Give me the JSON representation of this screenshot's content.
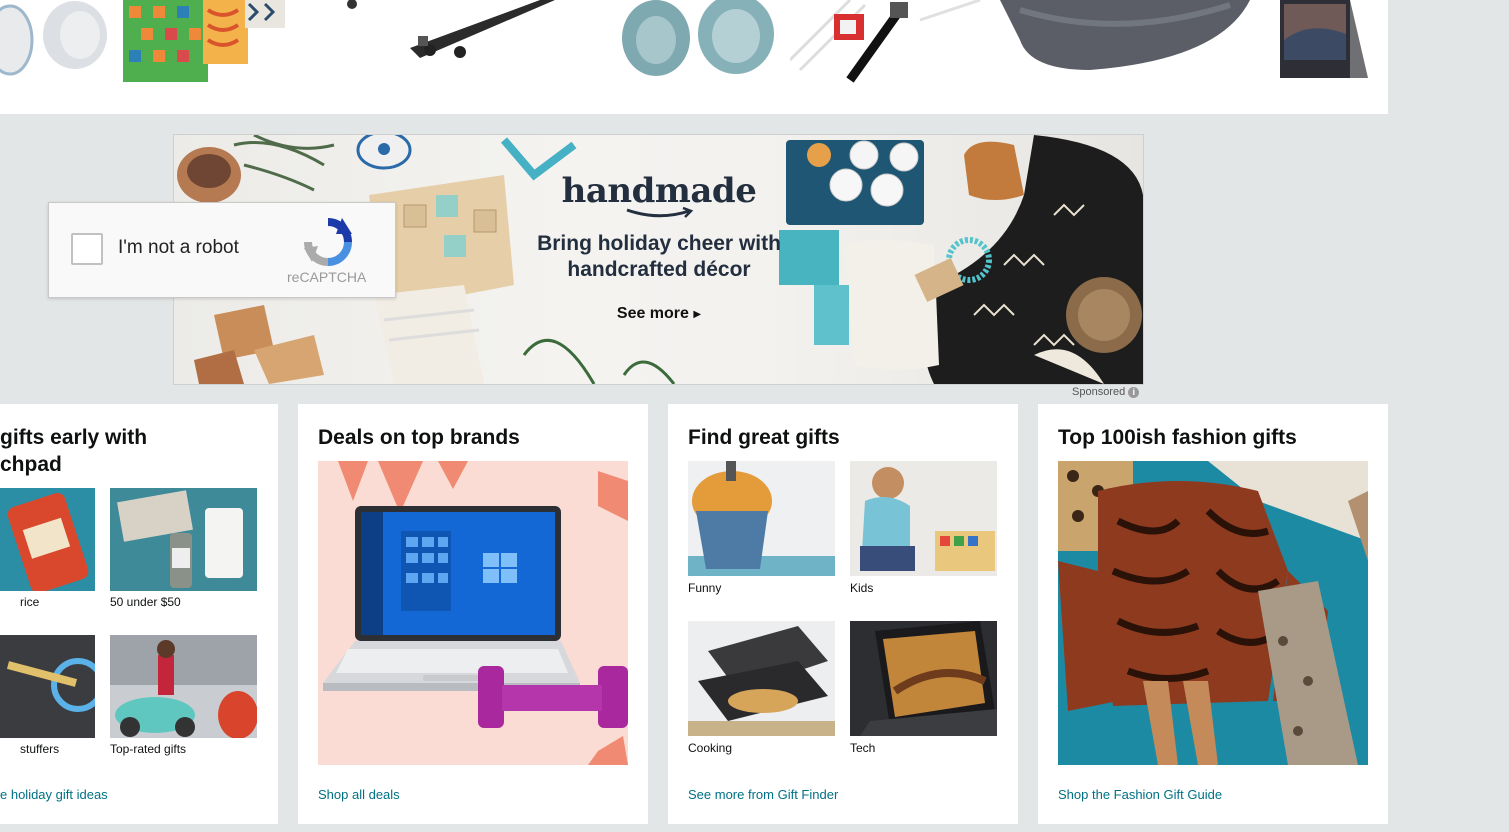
{
  "recaptcha": {
    "label": "I'm not a robot",
    "brand": "reCAPTCHA"
  },
  "banner": {
    "logo_text": "handmade",
    "headline_line1": "Bring holiday cheer with",
    "headline_line2": "handcrafted décor",
    "cta": "See more",
    "sponsored": "Sponsored"
  },
  "cards": [
    {
      "title_line1": "gifts early with",
      "title_line2": "chpad",
      "tiles": [
        "rice",
        "50 under $50",
        "stuffers",
        "Top-rated gifts"
      ],
      "link": "e holiday gift ideas"
    },
    {
      "title": "Deals on top brands",
      "link": "Shop all deals"
    },
    {
      "title": "Find great gifts",
      "tiles": [
        "Funny",
        "Kids",
        "Cooking",
        "Tech"
      ],
      "link": "See more from Gift Finder"
    },
    {
      "title": "Top 100ish fashion gifts",
      "link": "Shop the Fashion Gift Guide"
    }
  ],
  "colors": {
    "page_bg": "#e3e6e6",
    "link": "#007185",
    "banner_text": "#232f3e",
    "deals_bg": "#fbdcd4"
  }
}
